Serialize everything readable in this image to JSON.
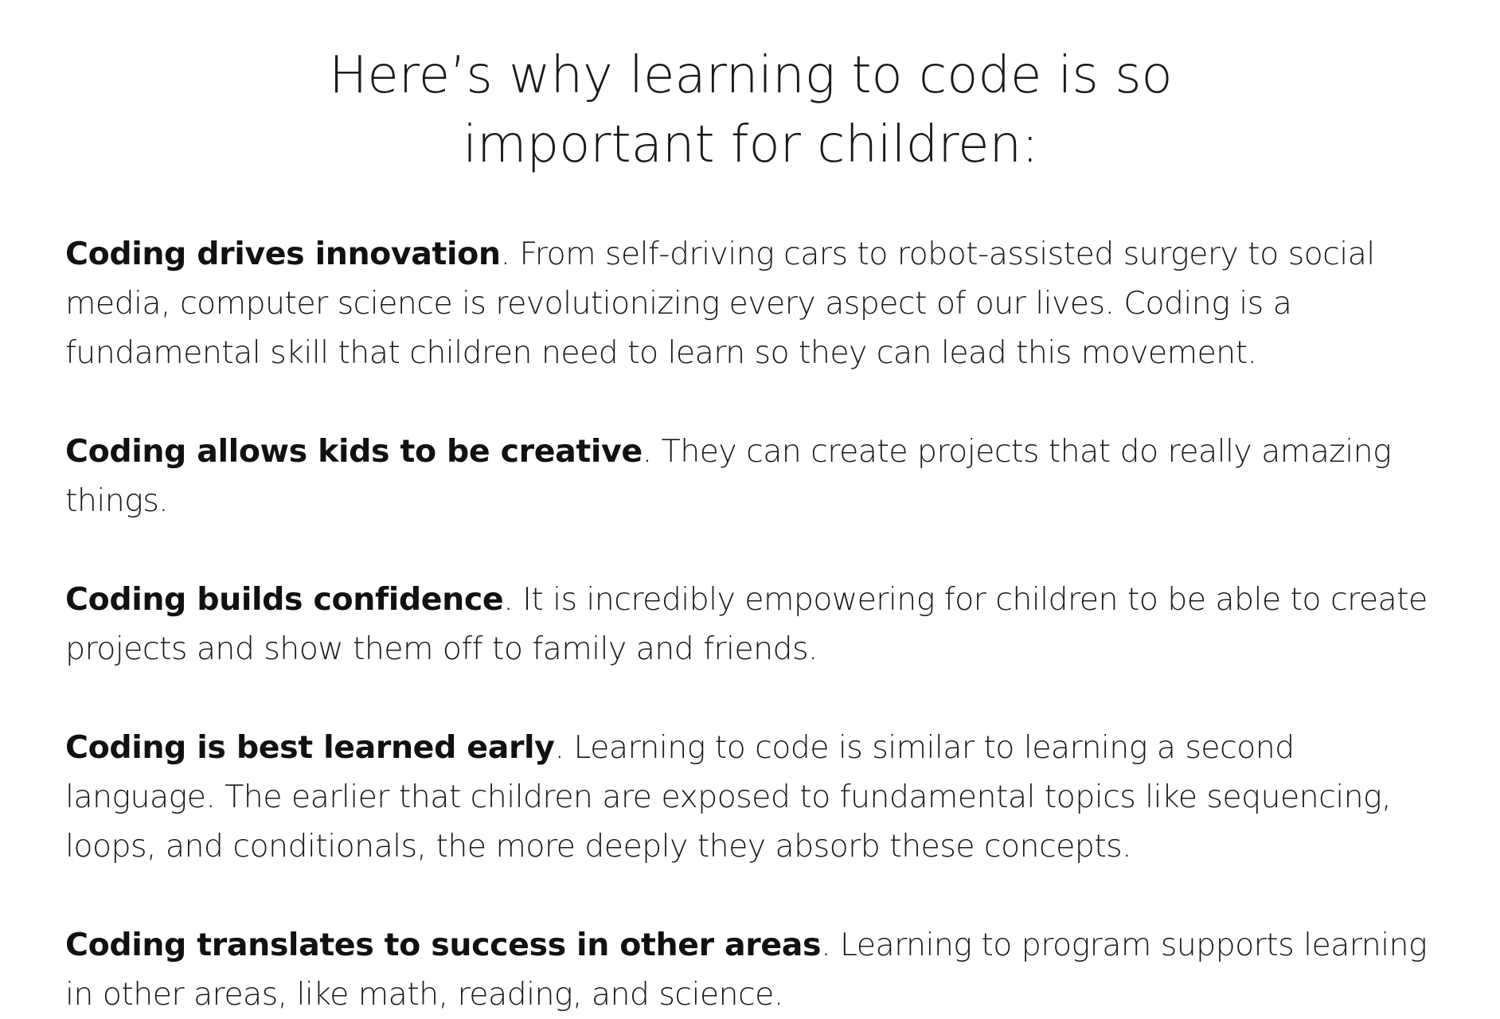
{
  "title": "Here’s why learning to code is so important for children:",
  "points": [
    {
      "heading": "Coding drives innovation",
      "separator": ".",
      "body": " From self-driving cars to robot-assisted surgery to social media, computer science is revolutionizing every aspect of our lives. Coding is a fundamental skill that children need to learn so they can lead this movement."
    },
    {
      "heading": "Coding allows kids to be creative",
      "separator": ".",
      "body": " They can create projects that do really amazing things."
    },
    {
      "heading": "Coding builds confidence",
      "separator": ".",
      "body": " It is incredibly empowering for children to be able to create projects and show them off to family and friends."
    },
    {
      "heading": "Coding is best learned early",
      "separator": ".",
      "body": " Learning to code is similar to learning a second language. The earlier that children are exposed to fundamental topics like sequencing, loops, and conditionals, the more deeply they absorb these concepts."
    },
    {
      "heading": "Coding translates to success in other areas",
      "separator": ".",
      "body": " Learning to program supports learning in other areas, like math, reading, and science."
    }
  ]
}
